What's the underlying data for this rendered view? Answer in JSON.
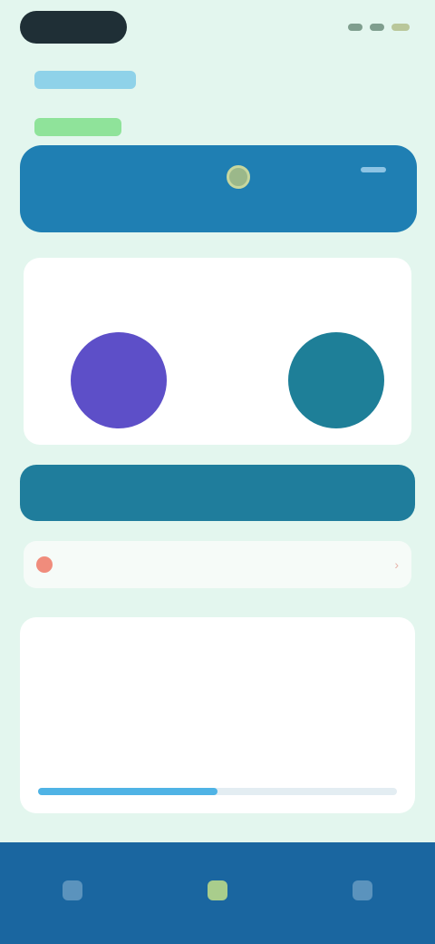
{
  "status_bar": {
    "icons": [
      "signal-icon",
      "wifi-icon",
      "battery-icon"
    ]
  },
  "header": {
    "greeting": "",
    "plan_tag": ""
  },
  "balance_card": {
    "label": "",
    "value": "",
    "icon": "eye-icon"
  },
  "stats": {
    "left": {
      "title": "",
      "value": ""
    },
    "right": {
      "title": "",
      "subtitle": "",
      "value": ""
    }
  },
  "action_button": {
    "label": ""
  },
  "alert": {
    "text": "",
    "icon": "warning-icon"
  },
  "summary": {
    "heading": "",
    "rows": [
      {
        "label": "",
        "value": ""
      },
      {
        "label": "",
        "value": ""
      },
      {
        "label": "",
        "value": ""
      }
    ],
    "progress": 0.5
  },
  "bottom_nav": {
    "items": [
      {
        "label": "",
        "icon": "home-icon"
      },
      {
        "label": "",
        "icon": "center-icon"
      },
      {
        "label": "",
        "icon": "profile-icon"
      }
    ]
  },
  "colors": {
    "background": "#e3f6ee",
    "primary": "#1f7fb3",
    "accent_purple": "#5d4fc8",
    "accent_teal": "#1e7f98",
    "nav": "#1a66a0"
  }
}
